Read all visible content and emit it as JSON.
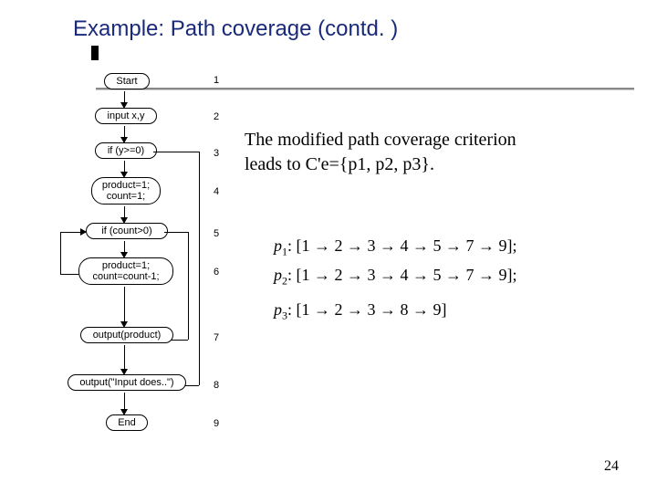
{
  "title": "Example: Path coverage (contd. )",
  "body": {
    "line1": "The modified path coverage criterion",
    "line2": "leads to  C'e={p1, p2, p3}."
  },
  "paths": {
    "p1_label": "p",
    "p1_sub": "1",
    "p1_expr": ": [1 → 2 → 3 → 4 → 5 → 7 → 9]",
    "p2_label": "p",
    "p2_sub": "2",
    "p2_expr": ": [1 → 2 → 3 → 4 → 5 → 7 → 9]",
    "p3_label": "p",
    "p3_sub": "3",
    "p3_expr": ": [1 → 2 → 3 → 8 → 9]"
  },
  "flow": {
    "n1": "Start",
    "n2": "input x,y",
    "n3": "if (y>=0)",
    "n4": "product=1;\ncount=1;",
    "n5": "if (count>0)",
    "n6": "product=1;\ncount=count-1;",
    "n7": "output(product)",
    "n8": "output(\"Input does..\")",
    "n9": "End",
    "num1": "1",
    "num2": "2",
    "num3": "3",
    "num4": "4",
    "num5": "5",
    "num6": "6",
    "num7": "7",
    "num8": "8",
    "num9": "9"
  },
  "page_number": "24"
}
